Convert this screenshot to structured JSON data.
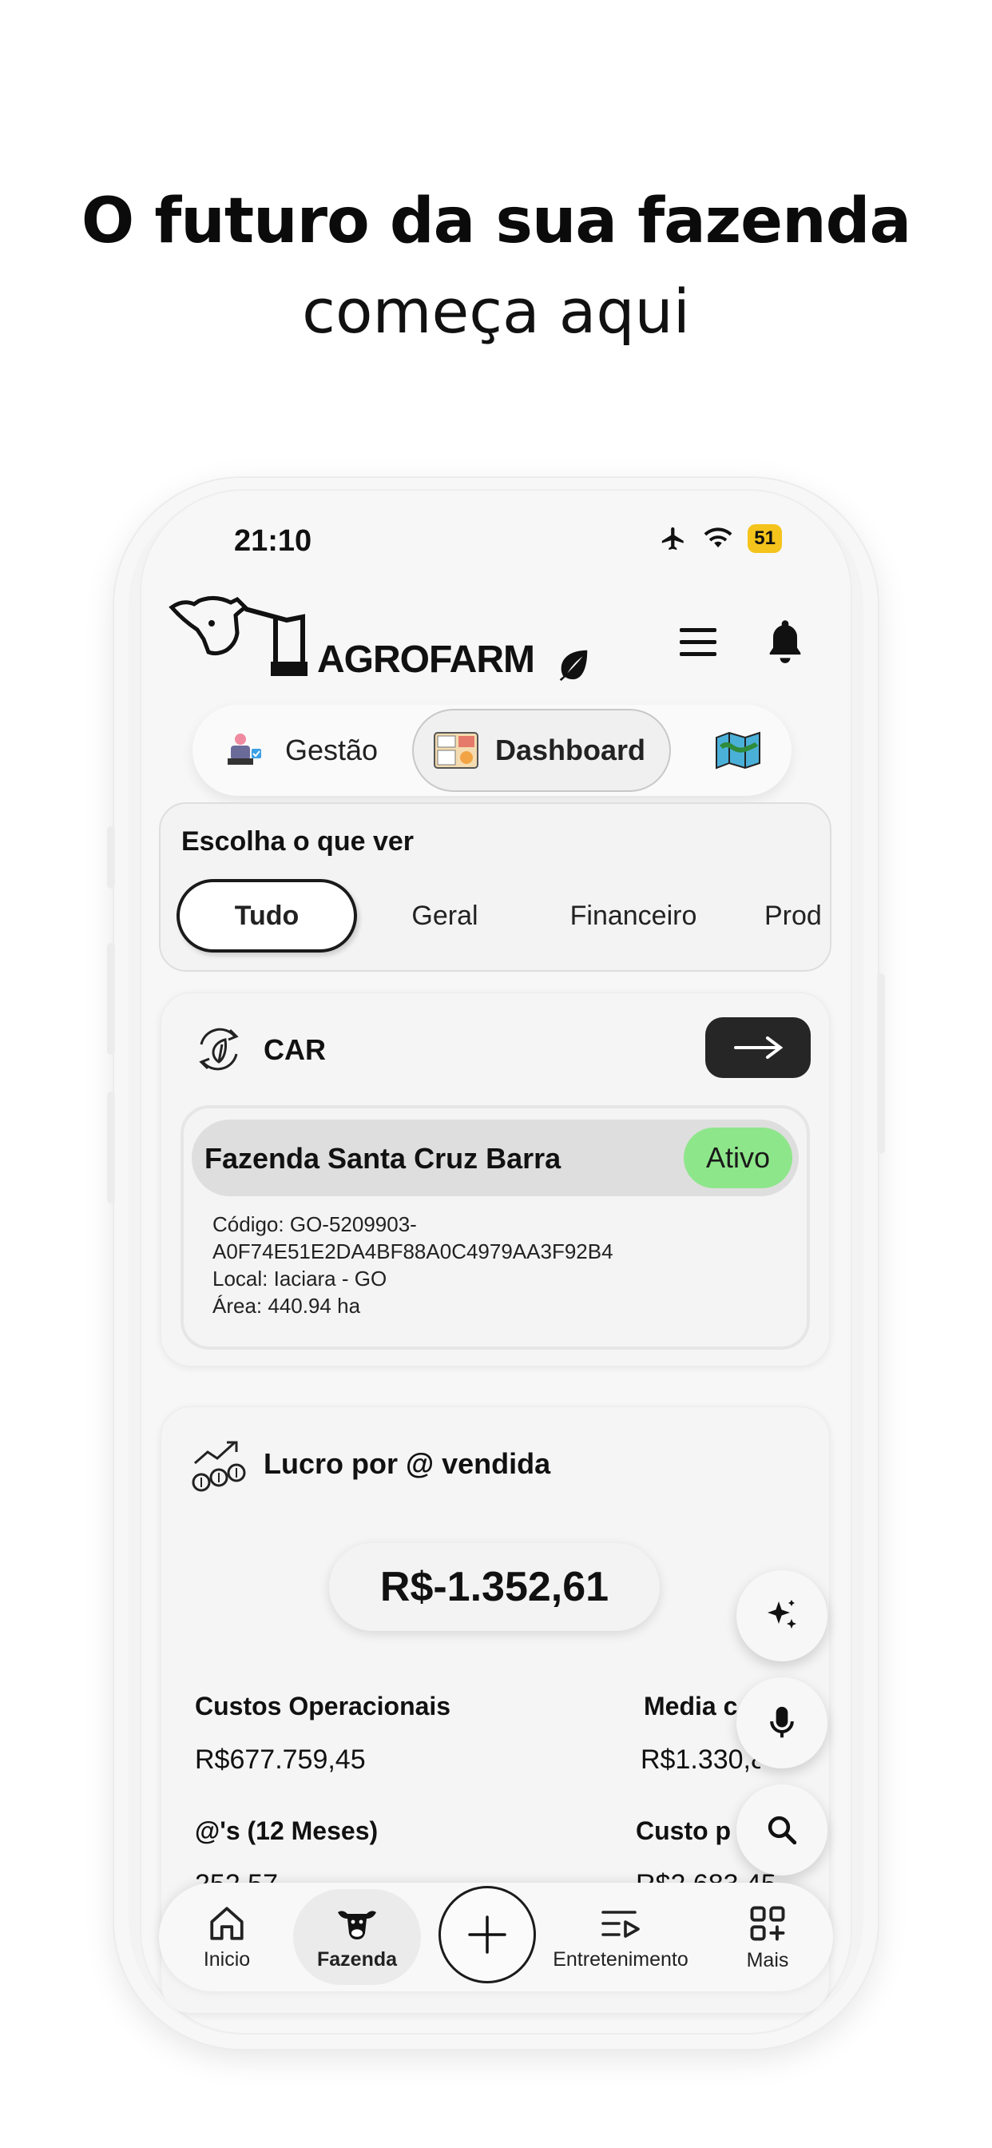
{
  "headline": {
    "line1": "O futuro da sua fazenda",
    "line2": "começa aqui"
  },
  "status_bar": {
    "time": "21:10",
    "battery": "51"
  },
  "app": {
    "logo_text": "AGROFARM"
  },
  "segments": {
    "items": [
      "Gestão",
      "Dashboard"
    ],
    "active": "Dashboard"
  },
  "filter": {
    "title": "Escolha o que ver",
    "chips": [
      "Tudo",
      "Geral",
      "Financeiro",
      "Prod"
    ],
    "active": "Tudo"
  },
  "car_card": {
    "title": "CAR",
    "farm_name": "Fazenda Santa Cruz Barra",
    "status": "Ativo",
    "code_line1": "Código: GO-5209903-",
    "code_line2": "A0F74E51E2DA4BF88A0C4979AA3F92B4",
    "local": "Local: Iaciara - GO",
    "area": "Área: 440.94 ha"
  },
  "profit_card": {
    "title": "Lucro por @ vendida",
    "value": "R$-1.352,61",
    "stats": [
      {
        "label": "Custos Operacionais",
        "value": "R$677.759,45"
      },
      {
        "label": "Media c",
        "value": "R$1.330,8"
      },
      {
        "label": "@'s (12 Meses)",
        "value": "252,57"
      },
      {
        "label": "Custo p",
        "value": "R$2.683,45"
      }
    ]
  },
  "tabbar": {
    "items": [
      "Inicio",
      "Fazenda",
      "Entretenimento",
      "Mais"
    ],
    "active": "Fazenda"
  },
  "colors": {
    "active_status": "#8ee68a",
    "battery": "#f4c41c",
    "dark_button": "#262626"
  }
}
